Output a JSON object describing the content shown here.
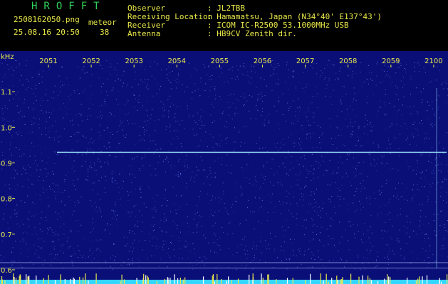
{
  "header": {
    "logo": "HROFFT",
    "filename": "2508162050.png",
    "datetime": "25.08.16 20:50",
    "count_label": "meteor",
    "count_value": "38",
    "fields": [
      {
        "label": "Observer",
        "value": ": JL2TBB"
      },
      {
        "label": "Receiving Location",
        "value": ": Hamamatsu, Japan (N34°40' E137°43')"
      },
      {
        "label": "Receiver",
        "value": ": ICOM IC-R2500 53.1000MHz USB"
      },
      {
        "label": "Antenna",
        "value": ": HB9CV Zenith dir."
      }
    ]
  },
  "spectrogram": {
    "y_unit": "kHz",
    "time_ticks": [
      "2051",
      "2052",
      "2053",
      "2054",
      "2055",
      "2056",
      "2057",
      "2058",
      "2059",
      "2100"
    ],
    "y_ticks": [
      {
        "label": "1.1",
        "value": 1.1
      },
      {
        "label": "1.0",
        "value": 1.0
      },
      {
        "label": "0.9",
        "value": 0.9
      },
      {
        "label": "0.8",
        "value": 0.8
      },
      {
        "label": "0.7",
        "value": 0.7
      },
      {
        "label": "0.6",
        "value": 0.6
      }
    ],
    "y_range": [
      0.58,
      1.19
    ],
    "carrier_khz": 0.93,
    "colors": {
      "background": "#0a0f78",
      "noise": "#6c8cff",
      "carrier": "#9fe8ff",
      "tick_text": "#e8e84a",
      "activity": "#e8e84a",
      "bottom_band": "#33d6ff"
    }
  }
}
